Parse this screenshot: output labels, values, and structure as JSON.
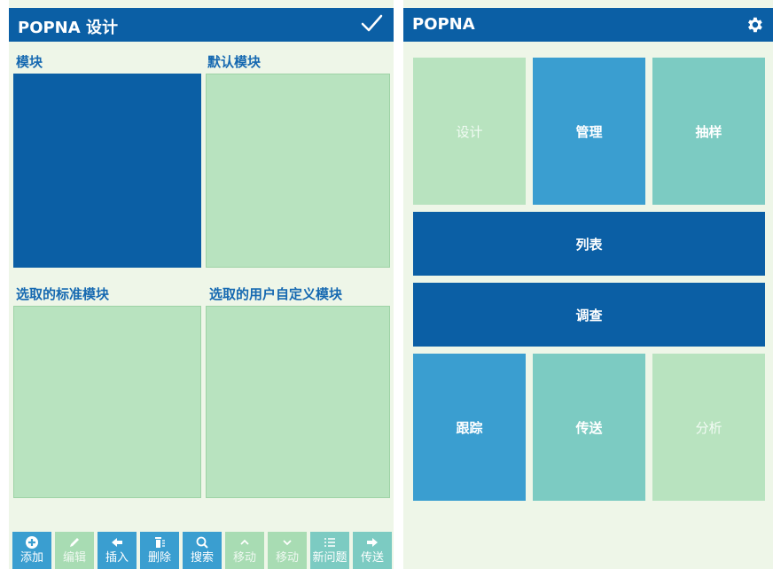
{
  "left": {
    "title": "POPNA  设计",
    "sections": {
      "modules": "模块",
      "default_modules": "默认模块",
      "selected_standard": "选取的标准模块",
      "selected_custom": "选取的用户自定义模块"
    },
    "toolbar": [
      {
        "label": "添加",
        "icon": "plus-circle-icon"
      },
      {
        "label": "编辑",
        "icon": "pencil-icon"
      },
      {
        "label": "插入",
        "icon": "arrow-left-icon"
      },
      {
        "label": "删除",
        "icon": "trash-icon"
      },
      {
        "label": "搜索",
        "icon": "search-icon"
      },
      {
        "label": "移动",
        "icon": "chevron-up-icon"
      },
      {
        "label": "移动",
        "icon": "chevron-down-icon"
      },
      {
        "label": "新问题",
        "icon": "list-icon"
      },
      {
        "label": "传送",
        "icon": "arrow-right-icon"
      }
    ]
  },
  "right": {
    "title": "POPNA",
    "tiles": {
      "design": "设计",
      "manage": "管理",
      "sampling": "抽样",
      "list": "列表",
      "survey": "调查",
      "tracking": "跟踪",
      "transfer": "传送",
      "analysis": "分析"
    }
  },
  "colors": {
    "brand": "#0b5fa5",
    "sky": "#3a9ed0",
    "teal": "#7ccbc2",
    "lightgreen": "#b8e3bf",
    "background": "#eef6e8"
  }
}
